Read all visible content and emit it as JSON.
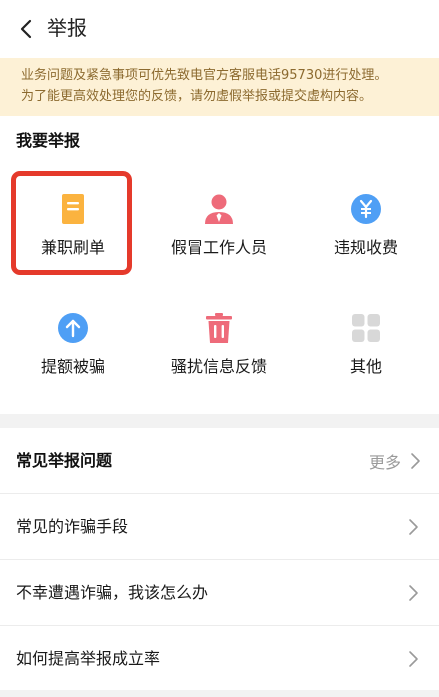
{
  "header": {
    "title": "举报"
  },
  "notice": {
    "line1": "业务问题及紧急事项可优先致电官方客服电话95730进行处理。",
    "line2": "为了能更高效处理您的反馈，请勿虚假举报或提交虚构内容。"
  },
  "report": {
    "title": "我要举报",
    "categories": [
      {
        "label": "兼职刷单",
        "icon": "document-icon",
        "color": "#fbb33f"
      },
      {
        "label": "假冒工作人员",
        "icon": "person-icon",
        "color": "#ee6b7a"
      },
      {
        "label": "违规收费",
        "icon": "yen-icon",
        "color": "#4f9ff5"
      },
      {
        "label": "提额被骗",
        "icon": "arrow-up-icon",
        "color": "#4f9ff5"
      },
      {
        "label": "骚扰信息反馈",
        "icon": "trash-icon",
        "color": "#ee6b7a"
      },
      {
        "label": "其他",
        "icon": "grid-icon",
        "color": "#d8d8d8"
      }
    ],
    "selected_highlight_color": "#e53a2b"
  },
  "faq": {
    "title": "常见举报问题",
    "more_label": "更多",
    "items": [
      {
        "label": "常见的诈骗手段"
      },
      {
        "label": "不幸遭遇诈骗，我该怎么办"
      },
      {
        "label": "如何提高举报成立率"
      }
    ]
  }
}
